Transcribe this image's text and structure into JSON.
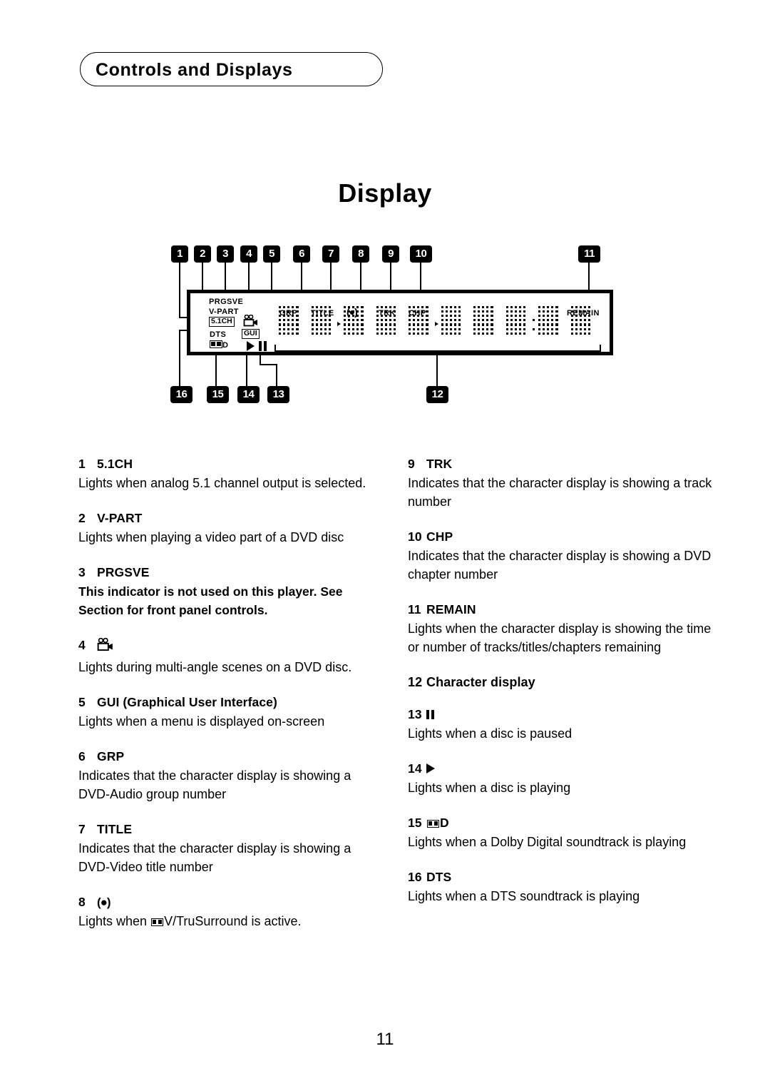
{
  "header": {
    "title": "Controls and Displays"
  },
  "section": {
    "title": "Display"
  },
  "diagram": {
    "name": "front-panel-display-diagram",
    "callouts": [
      "1",
      "2",
      "3",
      "4",
      "5",
      "6",
      "7",
      "8",
      "9",
      "10",
      "11",
      "12",
      "13",
      "14",
      "15",
      "16"
    ],
    "panel_indicators": [
      {
        "id": "prgsve",
        "label": "PRGSVE",
        "style": "plain"
      },
      {
        "id": "v-part",
        "label": "V-PART",
        "style": "plain"
      },
      {
        "id": "5-1ch",
        "label": "5.1CH",
        "style": "boxed"
      },
      {
        "id": "dts",
        "label": "DTS",
        "style": "plain"
      },
      {
        "id": "dolby-d",
        "label": "D",
        "style": "dolby-symbol"
      },
      {
        "id": "multi-angle",
        "label": "",
        "style": "camcorder-icon"
      },
      {
        "id": "gui",
        "label": "GUI",
        "style": "boxed"
      },
      {
        "id": "play",
        "label": "",
        "style": "play-icon"
      },
      {
        "id": "pause",
        "label": "",
        "style": "pause-icon"
      },
      {
        "id": "grp",
        "label": "GRP",
        "style": "plain"
      },
      {
        "id": "title",
        "label": "TITLE",
        "style": "plain"
      },
      {
        "id": "virtual-surround",
        "label": "(●)",
        "style": "plain"
      },
      {
        "id": "trk",
        "label": "TRK",
        "style": "plain"
      },
      {
        "id": "chp",
        "label": "CHP",
        "style": "plain"
      },
      {
        "id": "remain",
        "label": "REMAIN",
        "style": "plain"
      }
    ],
    "character_display_cells": 10
  },
  "entries_left": [
    {
      "num": "1",
      "title": "5.1CH",
      "body": "Lights when analog 5.1 channel output is selected.",
      "body2": null,
      "bold": false
    },
    {
      "num": "2",
      "title": "V-PART",
      "body": "Lights when playing a video part of a DVD disc",
      "body2": null,
      "bold": false
    },
    {
      "num": "3",
      "title": "PRGSVE",
      "body": "This indicator is not used on this player. See Section for front panel controls.",
      "body2": null,
      "bold": true
    },
    {
      "num": "4",
      "title": "",
      "icon": "camcorder-icon",
      "body": "Lights during multi-angle scenes on a DVD disc.",
      "body2": null,
      "bold": false
    },
    {
      "num": "5",
      "title": "GUI  (Graphical User Interface)",
      "body": "Lights when a menu is displayed on-screen",
      "body2": null,
      "bold": false
    },
    {
      "num": "6",
      "title": "GRP",
      "body": "Indicates that the character display is showing a DVD-Audio group number",
      "body2": null,
      "bold": false
    },
    {
      "num": "7",
      "title": "TITLE",
      "body": "Indicates that the character display is showing a DVD-Video title number",
      "body2": null,
      "bold": false
    },
    {
      "num": "8",
      "title": "(●)",
      "body_pre": "Lights when ",
      "body_post": "V/TruSurround is active.",
      "icon_inline": "dolby-symbol",
      "bold": false
    }
  ],
  "entries_right": [
    {
      "num": "9",
      "title": "TRK",
      "body": "Indicates that the character display is showing a track number",
      "bold": false
    },
    {
      "num": "10",
      "title": "CHP",
      "body": "Indicates that the character display is showing a DVD chapter number",
      "bold": false
    },
    {
      "num": "11",
      "title": "REMAIN",
      "body": "Lights when the character display is showing the time or number of tracks/titles/chapters remaining",
      "bold": false
    },
    {
      "num": "12",
      "title": "Character display",
      "body": "",
      "bold": false
    },
    {
      "num": "13",
      "title": "",
      "icon": "pause-icon",
      "body": "Lights when a disc is paused",
      "bold": false
    },
    {
      "num": "14",
      "title": "",
      "icon": "play-icon",
      "body": "Lights when a disc is playing",
      "bold": false
    },
    {
      "num": "15",
      "title": "D",
      "icon": "dolby-symbol",
      "body": "Lights when a Dolby Digital soundtrack is playing",
      "bold": false
    },
    {
      "num": "16",
      "title": "DTS",
      "body": "Lights when a DTS soundtrack is playing",
      "bold": false
    }
  ],
  "footer": {
    "page_number": "11"
  }
}
